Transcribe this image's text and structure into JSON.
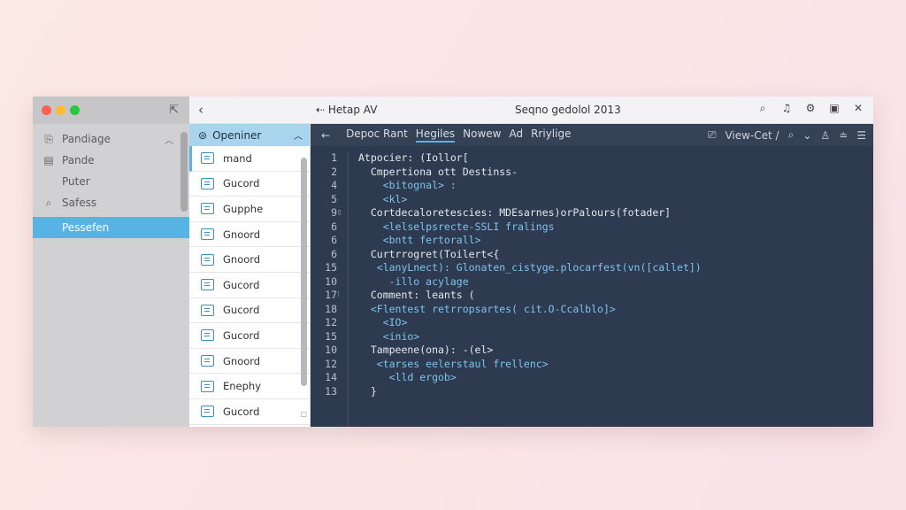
{
  "topbar": {
    "tab_label": "Hetap AV",
    "tab_icon": "arrow-left-icon",
    "window_title": "Seqno gedolol 2013"
  },
  "sidebar": {
    "items": [
      {
        "label": "Pandiage",
        "icon": "clipboard-icon"
      },
      {
        "label": "Pande",
        "icon": "calendar-icon"
      },
      {
        "label": "Puter",
        "icon": ""
      },
      {
        "label": "Safess",
        "icon": "search-icon"
      },
      {
        "label": "Pessefen",
        "icon": ""
      }
    ]
  },
  "filelist": {
    "header": "Openiner",
    "files": [
      "mand",
      "Gucord",
      "Gupphe",
      "Gnoord",
      "Gnoord",
      "Gucord",
      "Gucord",
      "Gucord",
      "Gnoord",
      "Enephy",
      "Gucord"
    ]
  },
  "editor": {
    "tabs": [
      "Depoc Rant",
      "Hegiles",
      "Nowew",
      "Ad",
      "Rriylige"
    ],
    "active_tab": "Hegiles",
    "view_label": "View-Cet /",
    "code_lines": [
      {
        "num": "1",
        "text": "Atpocier: (Iollor["
      },
      {
        "num": "2",
        "text": "  Cmpertiona ott Destinss-"
      },
      {
        "num": "4",
        "text": "    <bitognal> :"
      },
      {
        "num": "5",
        "text": "    <kl>"
      },
      {
        "num": "9",
        "text": "  Cortdecaloretescies: MDEsarnes)orPalours(fotader]"
      },
      {
        "num": "6",
        "text": "    <lelselpsrecte-SSLI fralings"
      },
      {
        "num": "6",
        "text": "    <bntt fertorall>"
      },
      {
        "num": "6",
        "text": "  Curtrrogret(Toilert<{"
      },
      {
        "num": "15",
        "text": "   <lanyLnect): Glonaten_cistyge.plocarfest(vn([callet])"
      },
      {
        "num": "10",
        "text": "     -illo acylage"
      },
      {
        "num": "17",
        "text": "  Comment: leants ("
      },
      {
        "num": "18",
        "text": "  <Flentest retrropsartes( cit.O-Ccalblo]>"
      },
      {
        "num": "12",
        "text": "    <IO>"
      },
      {
        "num": "15",
        "text": "    <inio>"
      },
      {
        "num": "10",
        "text": "  Tampeene(ona): -(el>"
      },
      {
        "num": "12",
        "text": "   <tarses eelerstaul frellenc>"
      },
      {
        "num": "14",
        "text": "     <lld ergob>"
      },
      {
        "num": "13",
        "text": "  }"
      }
    ]
  },
  "colors": {
    "accent": "#57b3e4",
    "editor_bg": "#2e3a4f",
    "sidebar_bg": "#d1d1d4"
  }
}
